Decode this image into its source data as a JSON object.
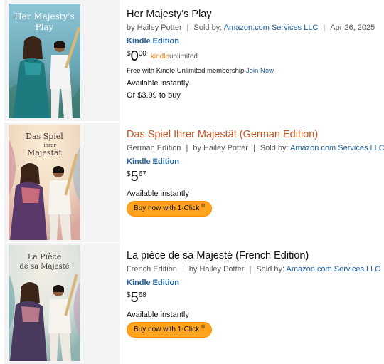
{
  "results": [
    {
      "cover_title": "Her Majesty's Play",
      "cover_title_lines": [
        "Her Majesty's",
        "Play"
      ],
      "title": "Her Majesty's Play",
      "title_color": "#0f1111",
      "edition_label": "",
      "author": "by Hailey Potter",
      "sold_by_label": "Sold by:",
      "seller": "Amazon.com Services LLC",
      "date": "Apr 26, 2025",
      "format": "Kindle Edition",
      "price": {
        "symbol": "$",
        "whole": "0",
        "fraction": "00"
      },
      "kindle_unlimited": {
        "part1": "kindle",
        "part2": "unlimited"
      },
      "membership": {
        "text": "Free with Kindle Unlimited membership",
        "link": "Join Now"
      },
      "availability": "Available instantly",
      "alt_price": "Or $3.99 to buy"
    },
    {
      "cover_title": "Das Spiel Ihrer Majestät",
      "cover_title_lines": [
        "Das Spiel",
        "ihrer",
        "Majestät"
      ],
      "title": "Das Spiel Ihrer Majestät (German Edition)",
      "title_color": "#c7511f",
      "edition_label": "German Edition",
      "author": "by Hailey Potter",
      "sold_by_label": "Sold by:",
      "seller": "Amazon.com Services LLC",
      "format": "Kindle Edition",
      "price": {
        "symbol": "$",
        "whole": "5",
        "fraction": "67"
      },
      "availability": "Available instantly",
      "buy_button": {
        "label": "Buy now with 1-Click",
        "reg": "®"
      }
    },
    {
      "cover_title": "La Pièce de sa Majesté",
      "cover_title_lines": [
        "La Pièce",
        "de sa Majesté"
      ],
      "title": "La pièce de sa Majesté (French Edition)",
      "title_color": "#0f1111",
      "edition_label": "French Edition",
      "author": "by Hailey Potter",
      "sold_by_label": "Sold by:",
      "seller": "Amazon.com Services LLC",
      "format": "Kindle Edition",
      "price": {
        "symbol": "$",
        "whole": "5",
        "fraction": "68"
      },
      "availability": "Available instantly",
      "buy_button": {
        "label": "Buy now with 1-Click",
        "reg": "®"
      }
    }
  ],
  "colors": {
    "link": "#2162a1",
    "title_orange": "#c7511f",
    "button": "#ffa41c",
    "ku_orange": "#e47911",
    "thumb_bg": "#f3f3f3"
  },
  "icons": [
    "book-cover-image"
  ]
}
